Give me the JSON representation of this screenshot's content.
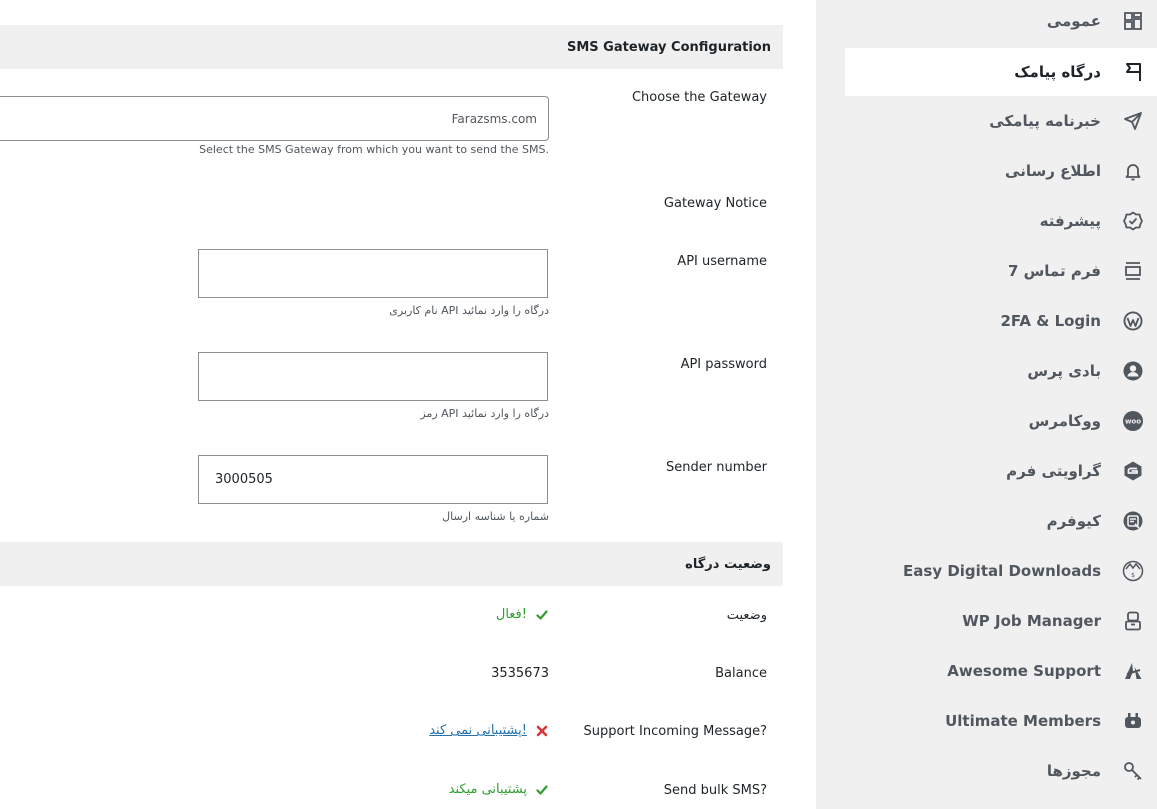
{
  "sidebar": {
    "items": [
      {
        "label": "عمومی",
        "icon": "dashboard-grid-icon",
        "active": false
      },
      {
        "label": "درگاه پیامک",
        "icon": "flag-icon",
        "active": true
      },
      {
        "label": "خبرنامه پیامکی",
        "icon": "send-icon",
        "active": false
      },
      {
        "label": "اطلاع رسانی",
        "icon": "bell-icon",
        "active": false
      },
      {
        "label": "پیشرفته",
        "icon": "check-badge-icon",
        "active": false
      },
      {
        "label": "فرم تماس 7",
        "icon": "form-icon",
        "active": false
      },
      {
        "label": "2FA & Login",
        "icon": "wordpress-icon",
        "active": false
      },
      {
        "label": "بادی پرس",
        "icon": "buddypress-icon",
        "active": false
      },
      {
        "label": "ووکامرس",
        "icon": "woocommerce-icon",
        "active": false
      },
      {
        "label": "گراویتی فرم",
        "icon": "gravity-forms-icon",
        "active": false
      },
      {
        "label": "کیوفرم",
        "icon": "quform-icon",
        "active": false
      },
      {
        "label": "Easy Digital Downloads",
        "icon": "edd-icon",
        "active": false
      },
      {
        "label": "WP Job Manager",
        "icon": "job-manager-icon",
        "active": false
      },
      {
        "label": "Awesome Support",
        "icon": "awesome-support-icon",
        "active": false
      },
      {
        "label": "Ultimate Members",
        "icon": "plug-icon",
        "active": false
      },
      {
        "label": "مجوزها",
        "icon": "key-icon",
        "active": false
      }
    ]
  },
  "config": {
    "header": "SMS Gateway Configuration",
    "gateway_label": "Choose the Gateway",
    "gateway_value": "Farazsms.com",
    "gateway_desc": "Select the SMS Gateway from which you want to send the SMS.",
    "notice_label": "Gateway Notice",
    "username_label": "API username",
    "username_value": "",
    "username_desc": "نام کاربری API درگاه را وارد نمائید",
    "password_label": "API password",
    "password_value": "",
    "password_desc": "رمز API درگاه را وارد نمائید",
    "sender_label": "Sender number",
    "sender_value": "3000505",
    "sender_desc": "شماره یا شناسه ارسال"
  },
  "status": {
    "header": "وضعیت درگاه",
    "status_label": "وضعیت",
    "status_value": "فعال!",
    "balance_label": "Balance",
    "balance_value": "3535673",
    "incoming_label": "Support Incoming Message?",
    "incoming_value": "پشتیبانی نمی کند!",
    "bulk_label": "Send bulk SMS?",
    "bulk_value": "پشتیبانی میکند"
  },
  "colors": {
    "ok": "#2f9e2f",
    "error": "#d63638",
    "link": "#2271b1",
    "sidebar_bg": "#f0f0f1"
  }
}
